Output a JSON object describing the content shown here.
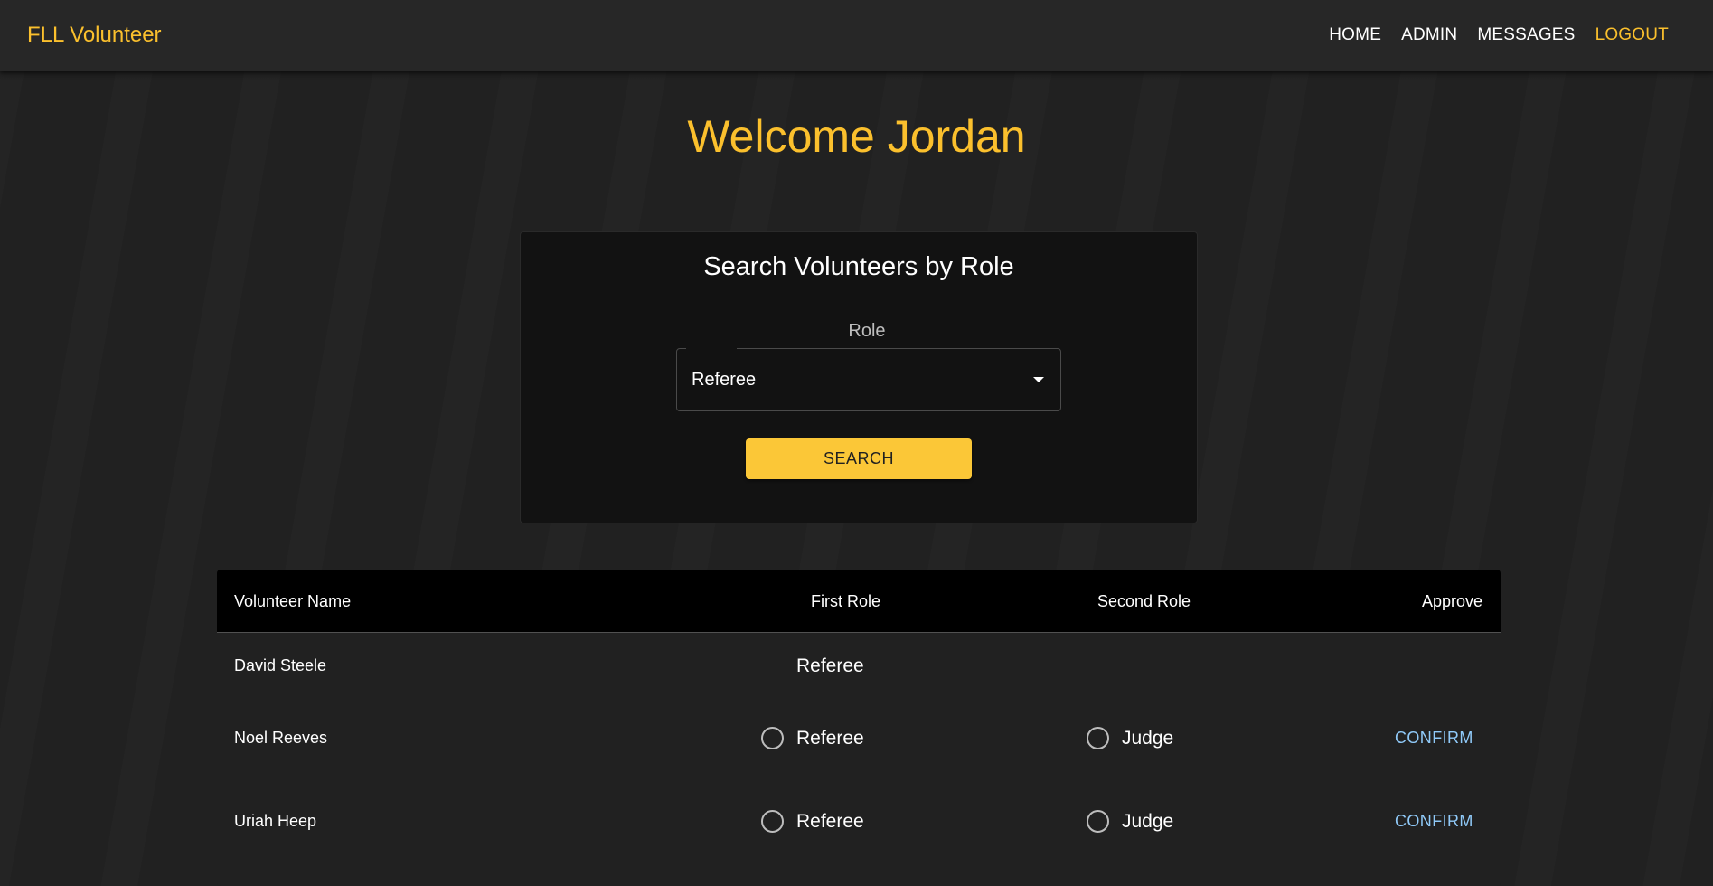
{
  "app": {
    "title": "FLL Volunteer"
  },
  "nav": {
    "items": [
      {
        "label": "HOME"
      },
      {
        "label": "ADMIN"
      },
      {
        "label": "MESSAGES"
      },
      {
        "label": "LOGOUT"
      }
    ]
  },
  "welcome": "Welcome Jordan",
  "search": {
    "title": "Search Volunteers by Role",
    "role_label": "Role",
    "selected_role": "Referee",
    "button_label": "SEARCH"
  },
  "table": {
    "headers": {
      "name": "Volunteer Name",
      "first_role": "First Role",
      "second_role": "Second Role",
      "approve": "Approve"
    },
    "rows": [
      {
        "name": "David Steele",
        "first_role": "Referee",
        "second_role": "",
        "approve": ""
      },
      {
        "name": "Noel Reeves",
        "first_role": "Referee",
        "second_role": "Judge",
        "approve": "CONFIRM"
      },
      {
        "name": "Uriah Heep",
        "first_role": "Referee",
        "second_role": "Judge",
        "approve": "CONFIRM"
      }
    ]
  },
  "colors": {
    "accent": "#fbc02d",
    "link": "#90caf9",
    "background": "#212121"
  }
}
